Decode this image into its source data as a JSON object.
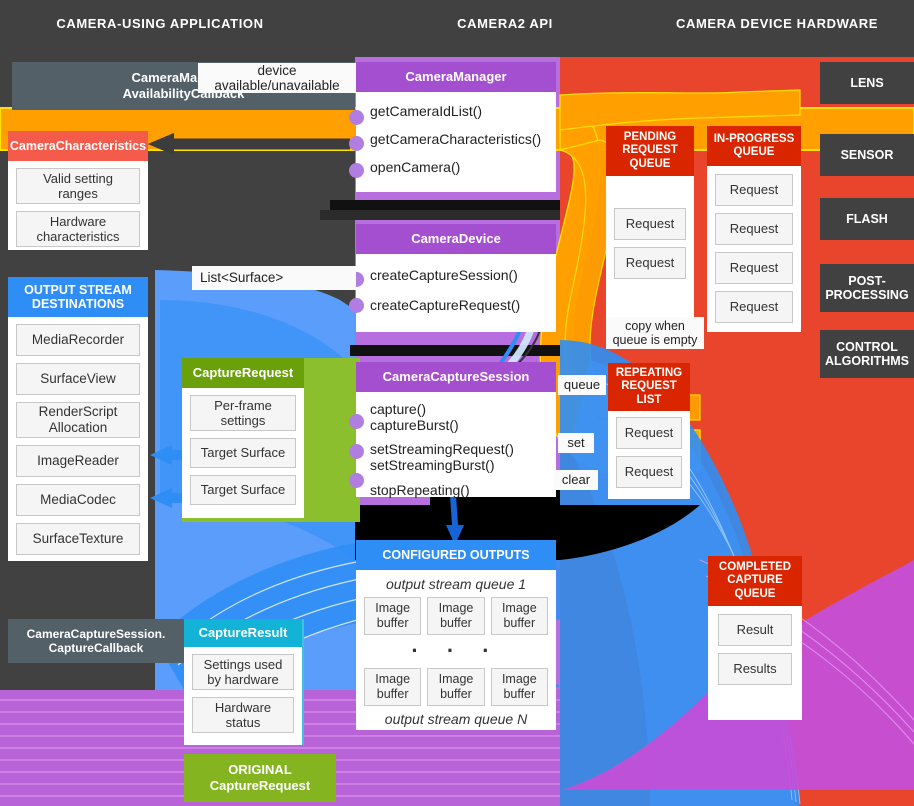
{
  "headers": [
    {
      "label": "CAMERA-USING APPLICATION"
    },
    {
      "label": "CAMERA2 API"
    },
    {
      "label": "CAMERA DEVICE HARDWARE"
    }
  ],
  "app": {
    "availability_callback": "CameraManager.\nAvailabilityCallback",
    "device_label": "device\navailable/unavailable",
    "characteristics": {
      "title": "CameraCharacteristics",
      "items": [
        "Valid setting\nranges",
        "Hardware\ncharacteristics"
      ]
    },
    "output_streams": {
      "title": "OUTPUT STREAM\nDESTINATIONS",
      "items": [
        "MediaRecorder",
        "SurfaceView",
        "RenderScript\nAllocation",
        "ImageReader",
        "MediaCodec",
        "SurfaceTexture"
      ]
    },
    "list_surface_label": "List<Surface>",
    "capture_request": {
      "title": "CaptureRequest",
      "items": [
        "Per-frame\nsettings",
        "Target Surface",
        "Target Surface"
      ]
    },
    "capture_callback": "CameraCaptureSession.\nCaptureCallback",
    "capture_result": {
      "title": "CaptureResult",
      "items": [
        "Settings used\nby hardware",
        "Hardware\nstatus"
      ]
    },
    "original_request": "ORIGINAL\nCaptureRequest"
  },
  "api": {
    "camera_manager": {
      "title": "CameraManager",
      "methods": [
        "getCameraIdList()",
        "getCameraCharacteristics()",
        "openCamera()"
      ]
    },
    "camera_device": {
      "title": "CameraDevice",
      "methods": [
        "createCaptureSession()",
        "createCaptureRequest()"
      ]
    },
    "capture_session": {
      "title": "CameraCaptureSession",
      "methods": [
        "capture()\ncaptureBurst()",
        "setStreamingRequest()\nsetStreamingBurst()",
        "stopRepeating()"
      ]
    },
    "configured_outputs": {
      "title": "CONFIGURED OUTPUTS",
      "queue_first": "output stream queue 1",
      "queue_last": "output stream queue N",
      "ellipsis": "· · ·",
      "buffer_label": "Image\nbuffer",
      "rows": 2,
      "cols": 3
    }
  },
  "hardware": {
    "pending_queue": {
      "title": "PENDING\nREQUEST\nQUEUE",
      "items": [
        "Request",
        "Request"
      ]
    },
    "inprogress_queue": {
      "title": "IN-PROGRESS\nQUEUE",
      "items": [
        "Request",
        "Request",
        "Request",
        "Request"
      ]
    },
    "copy_note": "copy when\nqueue is empty",
    "repeating_list": {
      "title": "REPEATING\nREQUEST\nLIST",
      "items": [
        "Request",
        "Request"
      ]
    },
    "queue_label": "queue",
    "set_label": "set",
    "clear_label": "clear",
    "completed_queue": {
      "title": "COMPLETED\nCAPTURE\nQUEUE",
      "items": [
        "Result",
        "Results"
      ]
    },
    "blocks": [
      "LENS",
      "SENSOR",
      "FLASH",
      "POST-\nPROCESSING",
      "CONTROL\nALGORITHMS"
    ]
  },
  "colors": {
    "dark": "#414141",
    "purple": "#a44fd0",
    "purple_light": "#b76fe0",
    "purple_bg": "#b863d8",
    "red": "#e8452c",
    "red_dark": "#d92600",
    "red_light": "#f96e5f",
    "blue": "#2e8ef6",
    "blue_light": "#5a9dfb",
    "green": "#6aa00a",
    "green_light": "#8cbf2e",
    "orange": "#ffa000",
    "cyan": "#12b3d6",
    "slate": "#546068",
    "yellow": "#ffe000"
  }
}
